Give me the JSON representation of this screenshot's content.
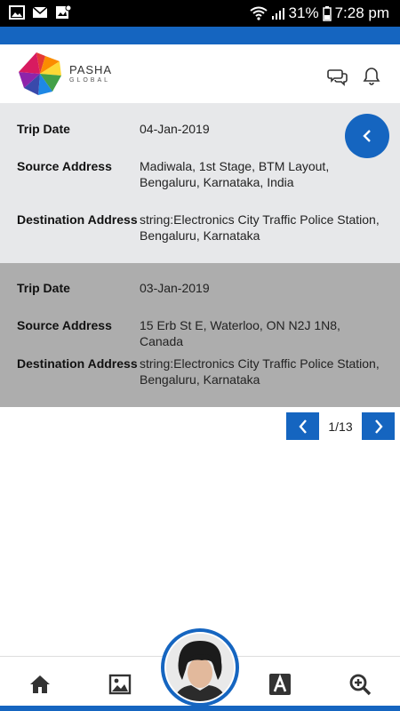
{
  "status_bar": {
    "battery_percent": "31%",
    "time": "7:28 pm"
  },
  "header": {
    "brand_name": "PASHA",
    "brand_sub": "GLOBAL",
    "icons": [
      "chat-icon",
      "bell-icon"
    ]
  },
  "trips": [
    {
      "trip_date_label": "Trip Date",
      "trip_date": "04-Jan-2019",
      "source_label": "Source Address",
      "source": "Madiwala, 1st Stage, BTM Layout, Bengaluru, Karnataka, India",
      "destination_label": "Destination Address",
      "destination": "string:Electronics City Traffic Police Station, Bengaluru, Karnataka"
    },
    {
      "trip_date_label": "Trip Date",
      "trip_date": "03-Jan-2019",
      "source_label": "Source Address",
      "source": "15 Erb St E, Waterloo, ON N2J 1N8, Canada",
      "destination_label": "Destination Address",
      "destination": "string:Electronics City Traffic Police Station, Bengaluru, Karnataka"
    }
  ],
  "pager": {
    "text": "1/13"
  },
  "bottom_nav": {
    "items": [
      "home-icon",
      "image-icon",
      "profile-avatar",
      "font-icon",
      "zoom-in-icon"
    ]
  },
  "colors": {
    "accent": "#1565c0",
    "card_light": "#e7e8ea",
    "card_dark": "#adadad"
  }
}
